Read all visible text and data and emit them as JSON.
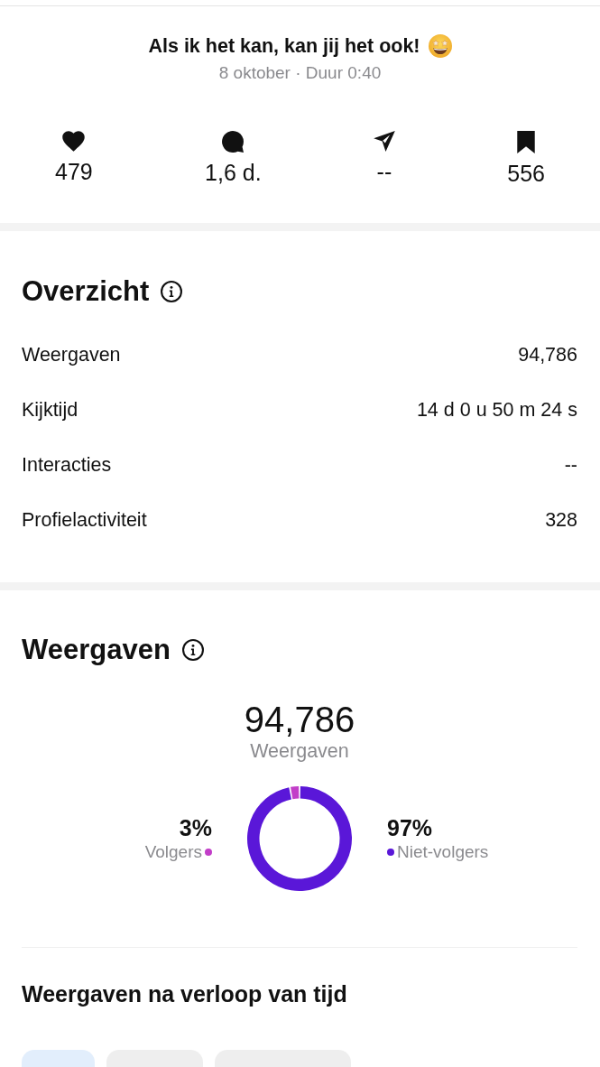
{
  "post": {
    "title": "Als ik het kan, kan jij het ook!",
    "meta": "8 oktober · Duur 0:40"
  },
  "stats": [
    {
      "kind": "likes",
      "value": "479"
    },
    {
      "kind": "comments",
      "value": "1,6 d."
    },
    {
      "kind": "shares",
      "value": "--"
    },
    {
      "kind": "saves",
      "value": "556"
    }
  ],
  "overview": {
    "title": "Overzicht",
    "rows": [
      {
        "label": "Weergaven",
        "value": "94,786"
      },
      {
        "label": "Kijktijd",
        "value": "14 d 0 u 50 m 24 s"
      },
      {
        "label": "Interacties",
        "value": "--"
      },
      {
        "label": "Profielactiviteit",
        "value": "328"
      }
    ]
  },
  "views": {
    "title": "Weergaven",
    "total": "94,786",
    "legend": [
      {
        "percent": "3%",
        "color": "#c23ec8"
      },
      {
        "percent": "97%",
        "color": "#5a17d8"
      }
    ],
    "chart_data": {
      "type": "donut",
      "categories": [
        "Volgers",
        "Niet-volgers"
      ],
      "series": [
        {
          "name": "Weergaven",
          "values": [
            3,
            97
          ]
        }
      ]
    }
  },
  "views_over_time": {
    "title": "Weergaven na verloop van tijd",
    "tabs": [
      {
        "selected": true
      },
      {
        "selected": false
      },
      {
        "selected": false
      }
    ]
  }
}
